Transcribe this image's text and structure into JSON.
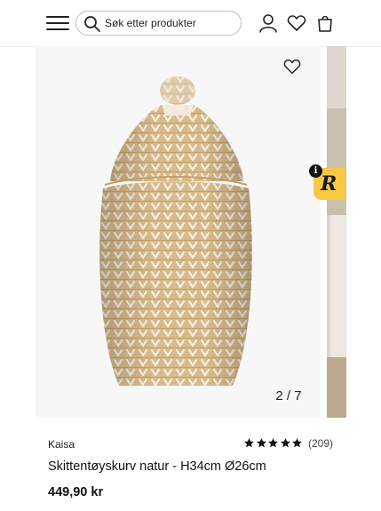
{
  "header": {
    "menu_icon": "hamburger-menu-icon",
    "search": {
      "placeholder": "Søk etter produkter",
      "icon": "search-icon"
    },
    "icons": [
      "user-icon",
      "heart-icon",
      "shopping-bag-icon"
    ]
  },
  "gallery": {
    "counter": "2 / 7",
    "favorite_icon": "heart-outline-icon",
    "badge_letter": "R",
    "info_letter": "i"
  },
  "product": {
    "brand": "Kaisa",
    "rating_stars": 5,
    "reviews": "(209)",
    "title": "Skittentøyskurv natur - H34cm Ø26cm",
    "price": "449,90 kr"
  },
  "colors": {
    "basket_base": "#d7bb8a",
    "basket_white": "#f4efe4",
    "badge": "#f7c842"
  }
}
